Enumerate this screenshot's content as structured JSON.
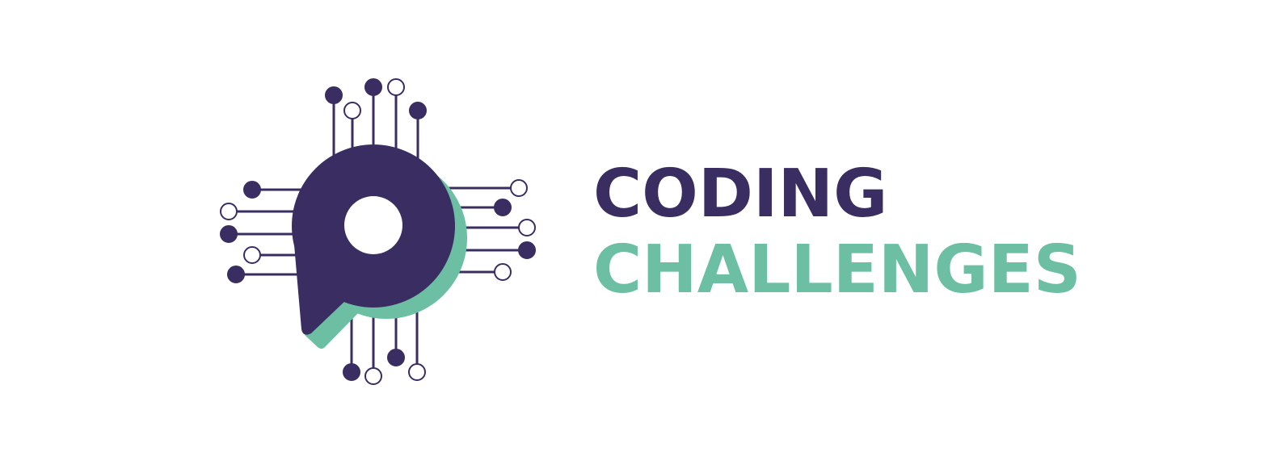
{
  "brand": {
    "line1": "CODING",
    "line2": "CHALLENGES",
    "colors": {
      "primary": "#3a2d62",
      "accent": "#6cbfa2",
      "background": "#ffffff"
    },
    "icon": "circuit-chip-p-icon"
  }
}
